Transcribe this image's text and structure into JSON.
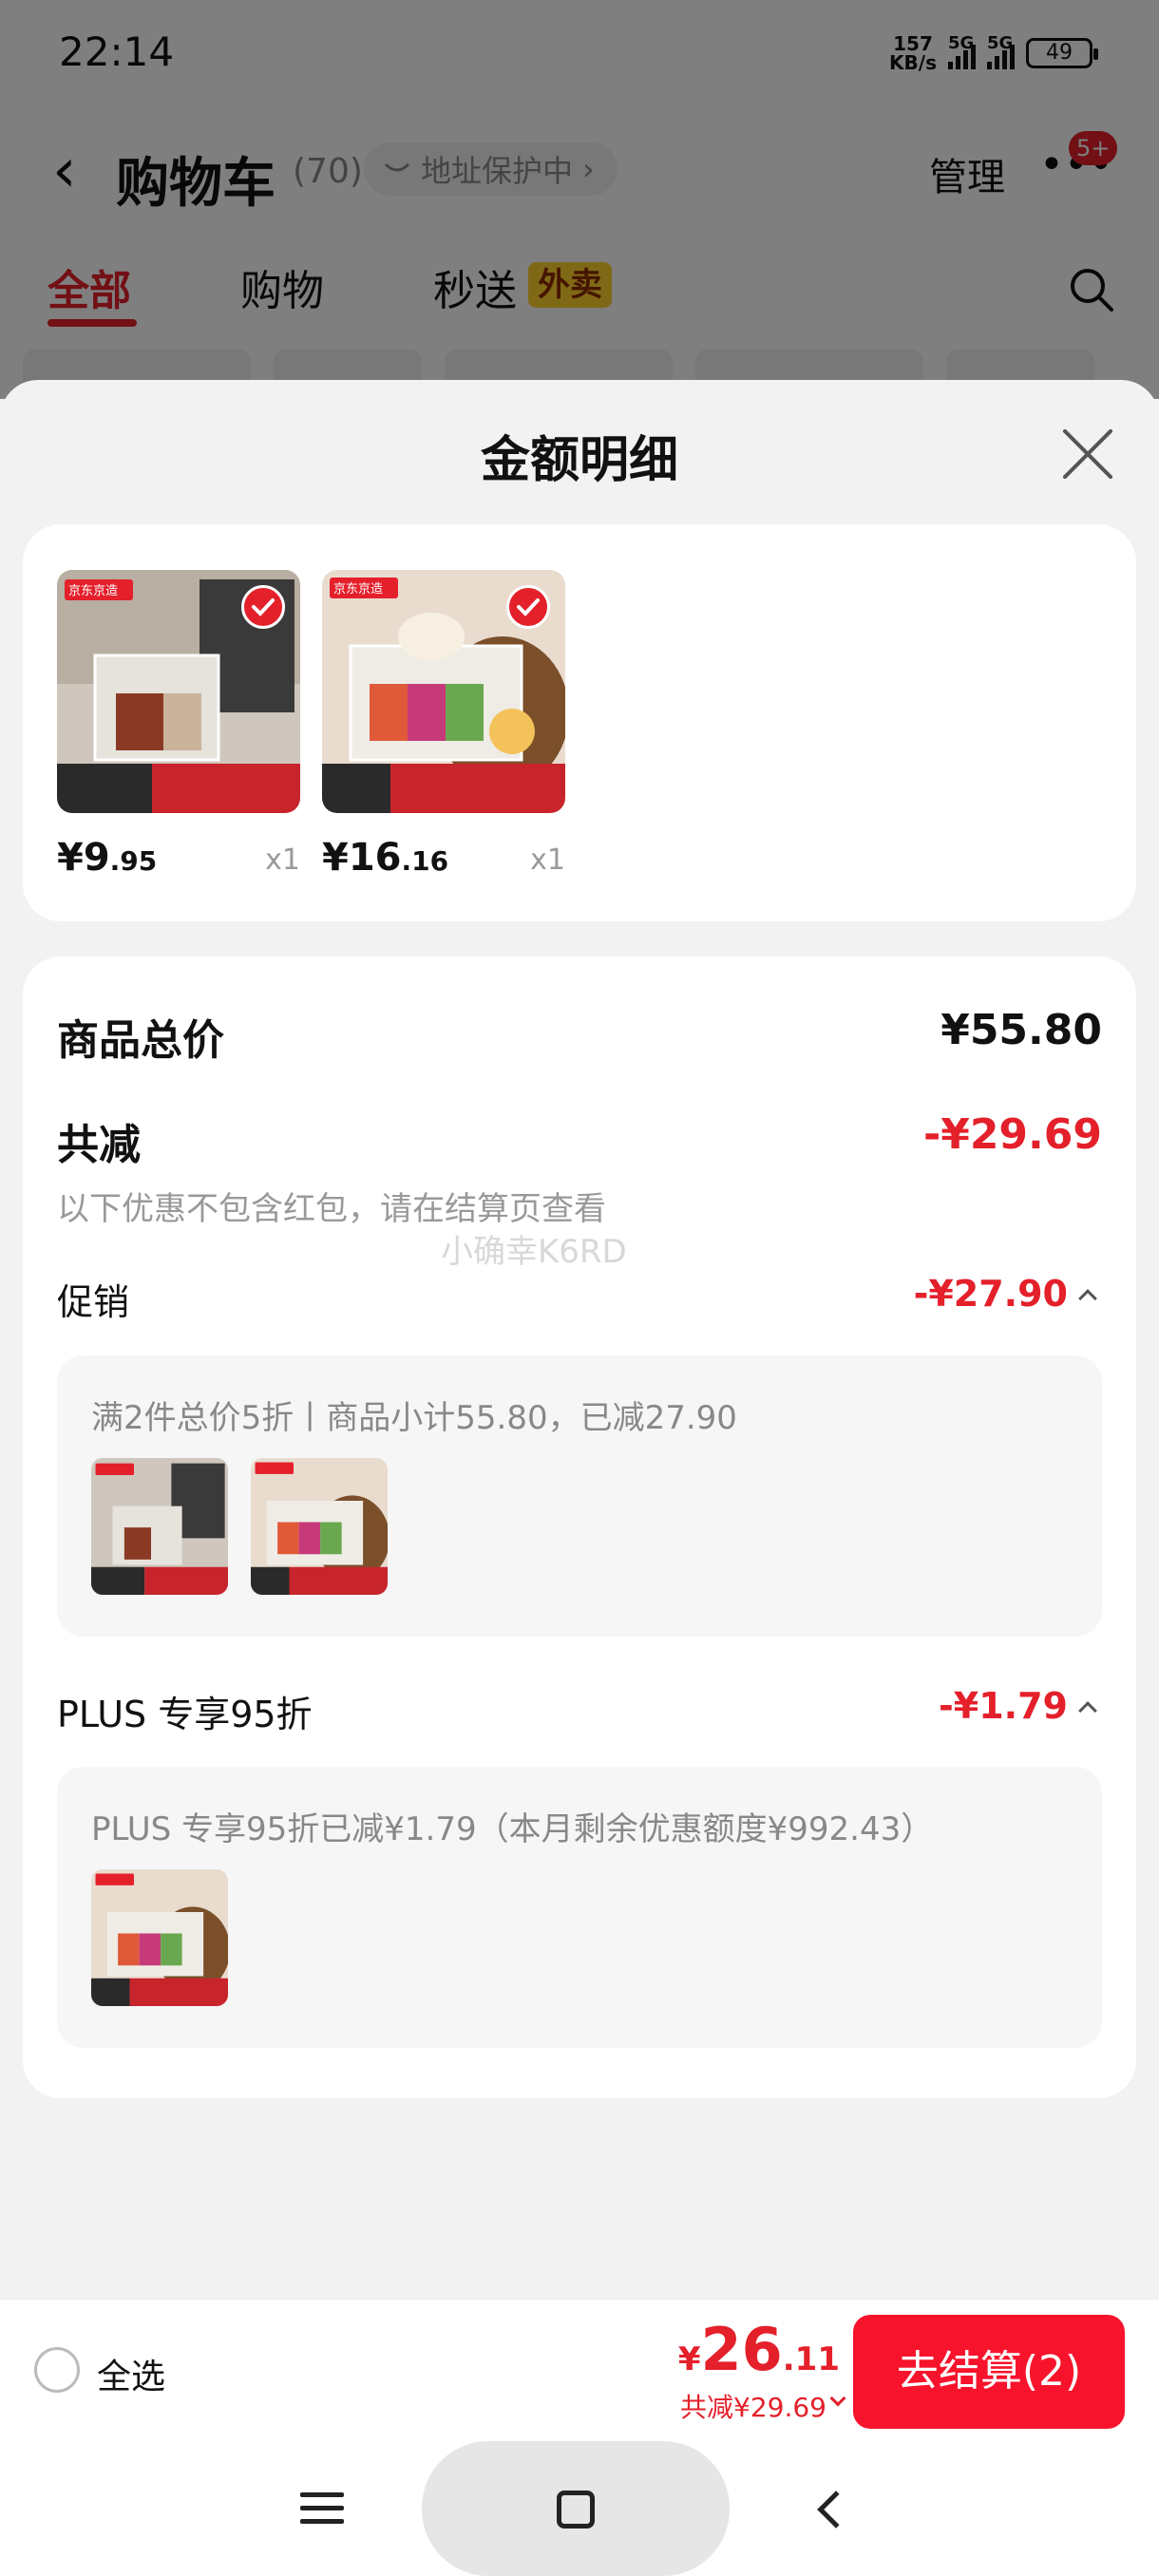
{
  "status_bar": {
    "time": "22:14",
    "net_speed_value": "157",
    "net_speed_unit": "KB/s",
    "signal1_label": "5G",
    "signal2_label": "5G",
    "battery": "49"
  },
  "cart_header": {
    "title": "购物车",
    "count": "(70)",
    "address_protect": "地址保护中",
    "manage": "管理",
    "more_badge": "5+"
  },
  "cart_tabs": [
    {
      "label": "全部"
    },
    {
      "label": "购物"
    },
    {
      "label": "秒送"
    }
  ],
  "waimai_badge": "外卖",
  "sheet": {
    "title": "金额明细"
  },
  "products": [
    {
      "price_int": "¥9",
      "price_dec": ".95",
      "qty": "x1",
      "brand": "京东京造"
    },
    {
      "price_int": "¥16",
      "price_dec": ".16",
      "qty": "x1",
      "brand": "京东京造"
    }
  ],
  "detail": {
    "total_label": "商品总价",
    "total_value": "¥55.80",
    "discount_label": "共减",
    "discount_value": "-¥29.69",
    "note": "以下优惠不包含红包，请在结算页查看",
    "watermark": "小确幸K6RD",
    "promo_label": "促销",
    "promo_value": "-¥27.90",
    "promo_desc": "满2件总价5折丨商品小计55.80，已减27.90",
    "plus_label": "PLUS 专享95折",
    "plus_value": "-¥1.79",
    "plus_desc": "PLUS 专享95折已减¥1.79（本月剩余优惠额度¥992.43）"
  },
  "bottom_bar": {
    "select_all": "全选",
    "currency": "¥",
    "total_int": "26",
    "total_dec": ".11",
    "total_discount": "共减¥29.69",
    "checkout": "去结算(2)"
  },
  "colors": {
    "accent_red": "#e4202b",
    "checkout_red": "#f8132c",
    "waimai_yellow": "#ffd22e"
  },
  "icons": [
    "back-chevron-icon",
    "shield-icon",
    "more-dots-icon",
    "search-icon",
    "close-icon",
    "check-icon",
    "chevron-up-icon",
    "chevron-down-icon",
    "menu-icon",
    "home-icon",
    "back-icon"
  ]
}
